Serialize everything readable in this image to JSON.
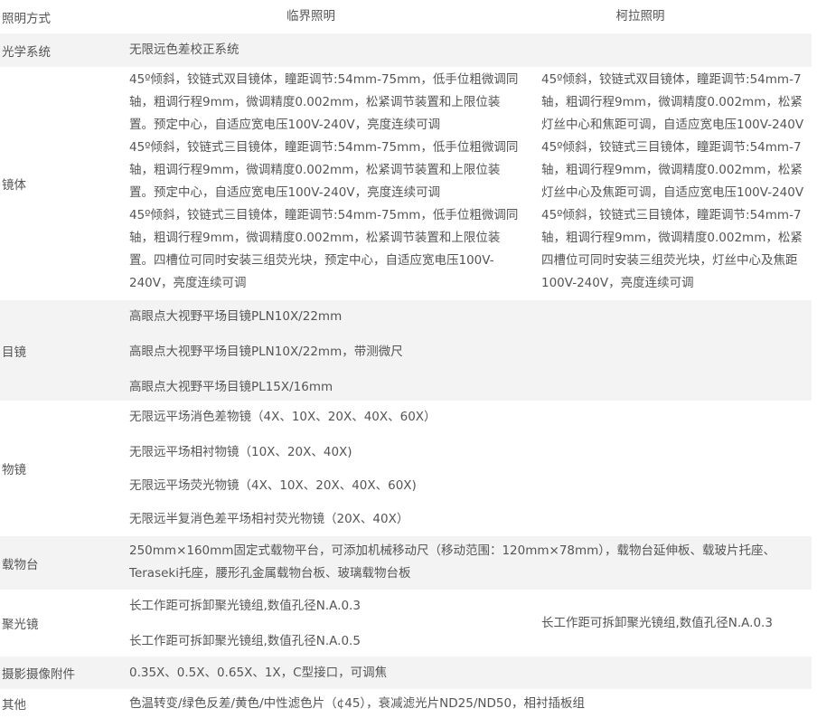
{
  "header": {
    "col1": "照明方式",
    "col2": "临界照明",
    "col3": "柯拉照明"
  },
  "optical_system": {
    "label": "光学系统",
    "value": "无限远色差校正系统"
  },
  "body": {
    "label": "镜体",
    "critical": [
      [
        "45º倾斜，铰链式双目镜体，瞳距调节:54mm-75mm，低手位粗微调同",
        "轴，粗调行程9mm，微调精度0.002mm，松紧调节装置和上限位装",
        "置。预定中心，自适应宽电压100V-240V，亮度连续可调"
      ],
      [
        "45º倾斜，铰链式三目镜体，瞳距调节:54mm-75mm，低手位粗微调同",
        "轴，粗调行程9mm，微调精度0.002mm，松紧调节装置和上限位装",
        "置。预定中心，自适应宽电压100V-240V，亮度连续可调"
      ],
      [
        "45º倾斜，铰链式三目镜体，瞳距调节:54mm-75mm，低手位粗微调同",
        "轴，粗调行程9mm，微调精度0.002mm，松紧调节装置和上限位装",
        "置。四槽位可同时安装三组荧光块，预定中心，自适应宽电压100V-",
        "240V，亮度连续可调"
      ]
    ],
    "kohler": [
      [
        "45º倾斜，铰链式双目镜体，瞳距调节:54mm-7",
        "轴，粗调行程9mm，微调精度0.002mm，松紧",
        "灯丝中心和焦距可调，自适应宽电压100V-240V"
      ],
      [
        "45º倾斜，铰链式三目镜体，瞳距调节:54mm-7",
        "轴，粗调行程9mm，微调精度0.002mm，松紧",
        "灯丝中心及焦距可调，自适应宽电压100V-240V"
      ],
      [
        "45º倾斜，铰链式三目镜体，瞳距调节:54mm-7",
        "轴，粗调行程9mm，微调精度0.002mm，松紧",
        "四槽位可同时安装三组荧光块，灯丝中心及焦距",
        "100V-240V，亮度连续可调"
      ]
    ]
  },
  "eyepiece": {
    "label": "目镜",
    "items": [
      "高眼点大视野平场目镜PLN10X/22mm",
      "高眼点大视野平场目镜PLN10X/22mm，带测微尺",
      "高眼点大视野平场目镜PL15X/16mm"
    ]
  },
  "objective": {
    "label": "物镜",
    "items": [
      "无限远平场消色差物镜（4X、10X、20X、40X、60X）",
      "无限远平场相衬物镜（10X、20X、40X)",
      "无限远平场荧光物镜（4X、10X、20X、40X、60X)",
      "无限远半复消色差平场相衬荧光物镜（20X、40X）"
    ]
  },
  "stage": {
    "label": "载物台",
    "lines": [
      "250mm×160mm固定式载物平台，可添加机械移动尺（移动范围：120mm×78mm），载物台延伸板、载玻片托座、",
      "Teraseki托座，腰形孔金属载物台板、玻璃载物台板"
    ]
  },
  "condenser": {
    "label": "聚光镜",
    "critical": [
      "长工作距可拆卸聚光镜组,数值孔径N.A.0.3",
      "长工作距可拆卸聚光镜组,数值孔径N.A.0.5"
    ],
    "kohler": "长工作距可拆卸聚光镜组,数值孔径N.A.0.3"
  },
  "camera": {
    "label": "摄影摄像附件",
    "value": "0.35X、0.5X、0.65X、1X，C型接口，可调焦"
  },
  "other": {
    "label": "其他",
    "value": "色温转变/绿色反差/黄色/中性滤色片（¢45），衰减滤光片ND25/ND50，相衬插板组"
  }
}
